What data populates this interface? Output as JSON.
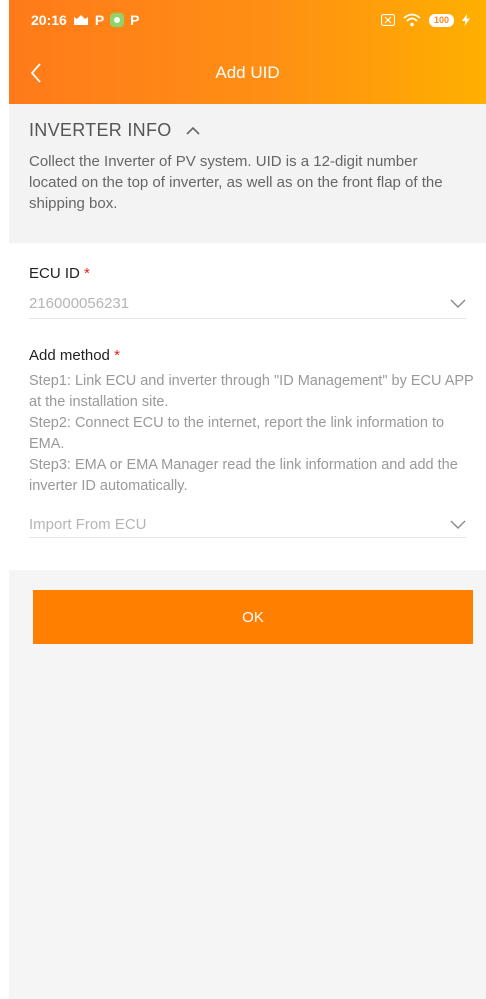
{
  "status_bar": {
    "time": "20:16",
    "battery": "100",
    "p_label": "P"
  },
  "nav": {
    "title": "Add UID"
  },
  "inverter_info": {
    "title": "INVERTER INFO",
    "description": "Collect the Inverter of PV system. UID is a 12-digit number located on the top of inverter, as well as on the front flap of the shipping box."
  },
  "ecu": {
    "label": "ECU ID",
    "required_mark": "*",
    "value": "216000056231"
  },
  "add_method": {
    "label": "Add method",
    "required_mark": "*",
    "steps": [
      "Step1: Link ECU and inverter through \"ID Management\" by ECU APP at the installation site.",
      "Step2: Connect ECU to the internet, report the link information to EMA.",
      "Step3: EMA or EMA Manager read the link information and add the inverter ID automatically."
    ],
    "value": "Import From ECU"
  },
  "actions": {
    "ok_label": "OK"
  },
  "colors": {
    "accent": "#ff7f00",
    "gradient_start": "#ff7a1a",
    "gradient_end": "#ffb000",
    "required": "#e2231a"
  }
}
